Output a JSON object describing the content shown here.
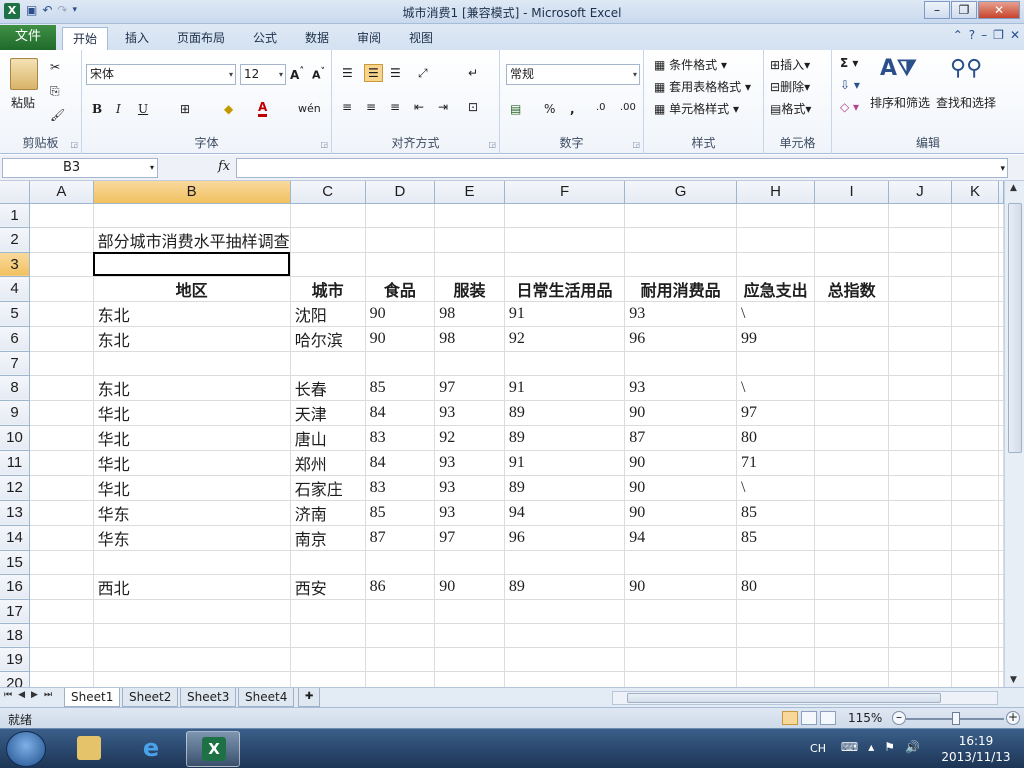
{
  "window": {
    "title": "城市消费1  [兼容模式] - Microsoft Excel"
  },
  "tabs": {
    "file": "文件",
    "items": [
      "开始",
      "插入",
      "页面布局",
      "公式",
      "数据",
      "审阅",
      "视图"
    ],
    "active": "开始"
  },
  "ribbon": {
    "clipboard": {
      "label": "剪贴板",
      "paste": "粘贴"
    },
    "font": {
      "label": "字体",
      "name": "宋体",
      "size": "12"
    },
    "alignment": {
      "label": "对齐方式"
    },
    "number": {
      "label": "数字",
      "format": "常规"
    },
    "styles": {
      "label": "样式",
      "conditional": "条件格式",
      "table": "套用表格格式",
      "cell_styles": "单元格样式"
    },
    "cells": {
      "label": "单元格",
      "insert": "插入",
      "delete": "删除",
      "format": "格式"
    },
    "editing": {
      "label": "编辑",
      "sort": "排序和筛选",
      "find": "查找和选择"
    }
  },
  "formula_bar": {
    "name_box": "B3",
    "fx": "fx",
    "content": ""
  },
  "grid": {
    "columns": [
      "A",
      "B",
      "C",
      "D",
      "E",
      "F",
      "G",
      "H",
      "I",
      "J",
      "K"
    ],
    "selected_column": "B",
    "selected_row": "3",
    "active_cell": "B3",
    "rows": [
      {
        "n": "1",
        "cells": [
          "",
          "",
          "",
          "",
          "",
          "",
          "",
          "",
          "",
          "",
          ""
        ]
      },
      {
        "n": "2",
        "cells": [
          "",
          "部分城市消费水平抽样调查",
          "",
          "",
          "",
          "",
          "",
          "",
          "",
          "",
          ""
        ]
      },
      {
        "n": "3",
        "cells": [
          "",
          "",
          "",
          "",
          "",
          "",
          "",
          "",
          "",
          "",
          ""
        ]
      },
      {
        "n": "4",
        "cells": [
          "",
          "地区",
          "城市",
          "食品",
          "服装",
          "日常生活用品",
          "耐用消费品",
          "应急支出",
          "总指数",
          "",
          ""
        ]
      },
      {
        "n": "5",
        "cells": [
          "",
          "东北",
          "沈阳",
          "90",
          "98",
          "91",
          "93",
          "\\",
          "",
          "",
          ""
        ]
      },
      {
        "n": "6",
        "cells": [
          "",
          "东北",
          "哈尔滨",
          "90",
          "98",
          "92",
          "96",
          "99",
          "",
          "",
          ""
        ]
      },
      {
        "n": "7",
        "cells": [
          "",
          "",
          "",
          "",
          "",
          "",
          "",
          "",
          "",
          "",
          ""
        ]
      },
      {
        "n": "8",
        "cells": [
          "",
          "东北",
          "长春",
          "85",
          "97",
          "91",
          "93",
          "\\",
          "",
          "",
          ""
        ]
      },
      {
        "n": "9",
        "cells": [
          "",
          "华北",
          "天津",
          "84",
          "93",
          "89",
          "90",
          "97",
          "",
          "",
          ""
        ]
      },
      {
        "n": "10",
        "cells": [
          "",
          "华北",
          "唐山",
          "83",
          "92",
          "89",
          "87",
          "80",
          "",
          "",
          ""
        ]
      },
      {
        "n": "11",
        "cells": [
          "",
          "华北",
          "郑州",
          "84",
          "93",
          "91",
          "90",
          "71",
          "",
          "",
          ""
        ]
      },
      {
        "n": "12",
        "cells": [
          "",
          "华北",
          "石家庄",
          "83",
          "93",
          "89",
          "90",
          "\\",
          "",
          "",
          ""
        ]
      },
      {
        "n": "13",
        "cells": [
          "",
          "华东",
          "济南",
          "85",
          "93",
          "94",
          "90",
          "85",
          "",
          "",
          ""
        ]
      },
      {
        "n": "14",
        "cells": [
          "",
          "华东",
          "南京",
          "87",
          "97",
          "96",
          "94",
          "85",
          "",
          "",
          ""
        ]
      },
      {
        "n": "15",
        "cells": [
          "",
          "",
          "",
          "",
          "",
          "",
          "",
          "",
          "",
          "",
          ""
        ]
      },
      {
        "n": "16",
        "cells": [
          "",
          "西北",
          "西安",
          "86",
          "90",
          "89",
          "90",
          "80",
          "",
          "",
          ""
        ]
      },
      {
        "n": "17",
        "cells": [
          "",
          "",
          "",
          "",
          "",
          "",
          "",
          "",
          "",
          "",
          ""
        ]
      },
      {
        "n": "18",
        "cells": [
          "",
          "",
          "",
          "",
          "",
          "",
          "",
          "",
          "",
          "",
          ""
        ]
      },
      {
        "n": "19",
        "cells": [
          "",
          "",
          "",
          "",
          "",
          "",
          "",
          "",
          "",
          "",
          ""
        ]
      },
      {
        "n": "20",
        "cells": [
          "",
          "",
          "",
          "",
          "",
          "",
          "",
          "",
          "",
          "",
          ""
        ]
      }
    ]
  },
  "sheets": {
    "tabs": [
      "Sheet1",
      "Sheet2",
      "Sheet3",
      "Sheet4"
    ],
    "active": "Sheet1"
  },
  "status": {
    "ready": "就绪",
    "zoom": "115%"
  },
  "taskbar": {
    "ime": "CH",
    "time": "16:19",
    "date": "2013/11/13"
  }
}
